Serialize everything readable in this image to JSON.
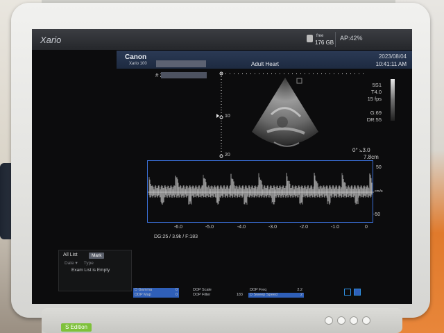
{
  "app": {
    "brand": "Xario"
  },
  "status": {
    "storage_label": "free",
    "storage_value": "176 GB",
    "ap": "AP:42%"
  },
  "header": {
    "maker": "Canon",
    "model": "Xario 100",
    "preset": "Adult Heart",
    "date": "2023/08/04",
    "time": "10:41:11 AM"
  },
  "image": {
    "frame_number": "# 295",
    "depth_10": "10",
    "depth_20": "20",
    "params": [
      "5S1",
      "T4.0",
      "15 fps",
      "",
      "G:69",
      "DR:55"
    ],
    "angle": "0°  ⦣3.0",
    "depth_cm": "7.8cm"
  },
  "doppler": {
    "scale_top": "50",
    "scale_bottom": "-50",
    "unit": "cm/s",
    "time_ticks": [
      "-6.0",
      "-5.0",
      "-4.0",
      "-3.0",
      "-2.0",
      "-1.0",
      "0"
    ],
    "settings": "DG:25  / 3.9k   / F:183"
  },
  "exam": {
    "all_list": "All List",
    "mark": "Mark",
    "col_date": "Date",
    "col_type": "Type",
    "empty": "Exam List is Empty"
  },
  "footer": {
    "d_gamma_label": "D Gamma",
    "d_gamma_value": "0",
    "ddp_map_label": "DDP Map",
    "ddp_map_value": "0",
    "ddp_scale_label": "DDP Scale",
    "ddp_scale_value": "",
    "ddp_filter_label": "DDP Filter",
    "ddp_filter_value": "183",
    "ddp_freq_label": "DDP Freq",
    "ddp_freq_value": "2.2",
    "sweep_label": "D Sweep Speed",
    "sweep_value": "2"
  },
  "monitor": {
    "edition": "S Edition"
  },
  "colors": {
    "accent": "#3a6fd6",
    "footer_highlight": "#2f5fb8"
  }
}
